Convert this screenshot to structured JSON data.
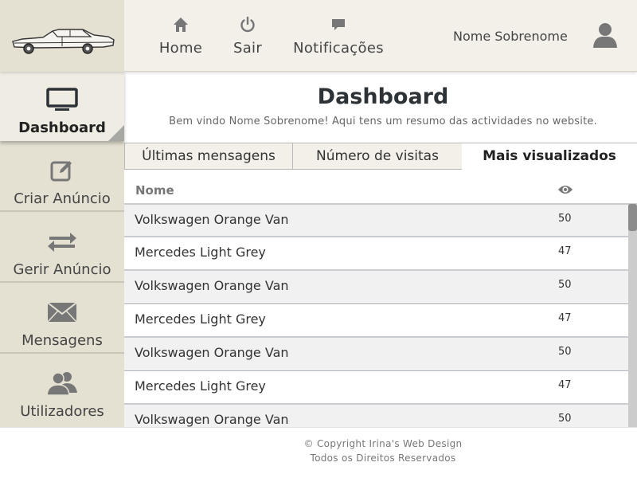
{
  "header": {
    "logo_icon": "car-logo-icon",
    "nav": [
      {
        "label": "Home",
        "icon": "home-icon"
      },
      {
        "label": "Sair",
        "icon": "power-icon"
      },
      {
        "label": "Notificações",
        "icon": "chat-bubble-icon"
      }
    ],
    "user_name": "Nome Sobrenome",
    "user_icon": "user-avatar-icon"
  },
  "sidebar": {
    "items": [
      {
        "label": "Dashboard",
        "icon": "monitor-icon",
        "active": true
      },
      {
        "label": "Criar Anúncio",
        "icon": "edit-icon"
      },
      {
        "label": "Gerir Anúncio",
        "icon": "swap-arrows-icon"
      },
      {
        "label": "Mensagens",
        "icon": "envelope-icon"
      },
      {
        "label": "Utilizadores",
        "icon": "users-icon"
      }
    ]
  },
  "main": {
    "title": "Dashboard",
    "subtitle": "Bem vindo Nome Sobrenome! Aqui tens um resumo das actividades no website.",
    "tabs": [
      {
        "label": "Últimas mensagens"
      },
      {
        "label": "Número de visitas"
      },
      {
        "label": "Mais visualizados",
        "active": true
      }
    ],
    "table": {
      "col_name": "Nome",
      "col_views_icon": "eye-icon",
      "rows": [
        {
          "name": "Volkswagen Orange Van",
          "views": "50"
        },
        {
          "name": "Mercedes Light Grey",
          "views": "47"
        },
        {
          "name": "Volkswagen Orange Van",
          "views": "50"
        },
        {
          "name": "Mercedes Light Grey",
          "views": "47"
        },
        {
          "name": "Volkswagen Orange Van",
          "views": "50"
        },
        {
          "name": "Mercedes Light Grey",
          "views": "47"
        },
        {
          "name": "Volkswagen Orange Van",
          "views": "50"
        }
      ]
    }
  },
  "footer": {
    "copyright": "© Copyright Irina's Web Design",
    "rights": "Todos os Direitos Reservados"
  },
  "colors": {
    "header_bg": "#f3f0e9",
    "sidebar_bg": "#e5e1d2",
    "text_dark": "#2d3236",
    "scroll_thumb": "#8c8c8c"
  }
}
